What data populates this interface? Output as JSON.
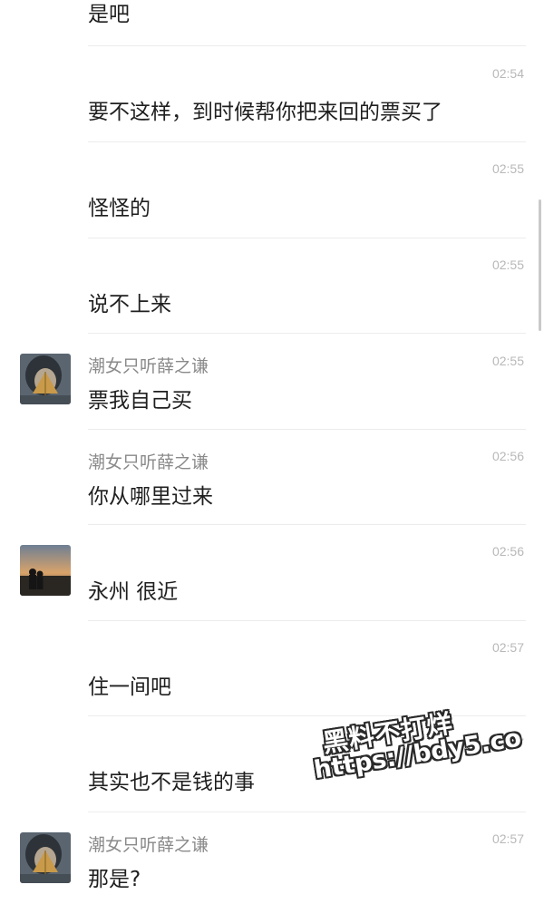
{
  "messages": [
    {
      "text": "是吧",
      "time": "",
      "sender": ""
    },
    {
      "text": "要不这样，到时候帮你把来回的票买了",
      "time": "02:54",
      "sender": ""
    },
    {
      "text": "怪怪的",
      "time": "02:55",
      "sender": ""
    },
    {
      "text": "说不上来",
      "time": "02:55",
      "sender": ""
    },
    {
      "text": "票我自己买",
      "time": "02:55",
      "sender": "潮女只听薛之谦"
    },
    {
      "text": "你从哪里过来",
      "time": "02:56",
      "sender": "潮女只听薛之谦"
    },
    {
      "text": "永州 很近",
      "time": "02:56",
      "sender": ""
    },
    {
      "text": "住一间吧",
      "time": "02:57",
      "sender": ""
    },
    {
      "text": "其实也不是钱的事",
      "time": "02:57",
      "sender": ""
    },
    {
      "text": "那是?",
      "time": "02:57",
      "sender": "潮女只听薛之谦"
    }
  ],
  "avatars": {
    "female": "avatar-girl-with-leaf",
    "male": "avatar-couple-sunset"
  },
  "watermark": {
    "line1": "黑料不打烊",
    "line2": "https://bdy5.co"
  }
}
